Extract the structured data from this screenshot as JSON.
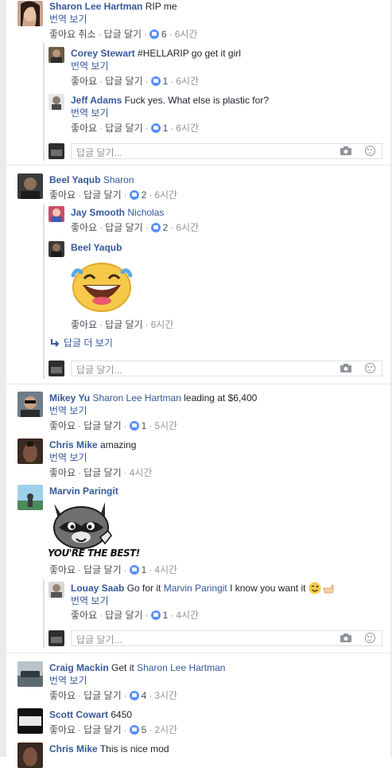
{
  "colors": {
    "link": "#365899",
    "meta": "#4b4f56",
    "time": "#90949c",
    "like": "#5890ff",
    "border": "#dddfe2"
  },
  "labels": {
    "like": "좋아요",
    "unlike": "좋아요 취소",
    "reply": "답글 달기",
    "translate": "번역 보기",
    "reply_placeholder": "답글 달기...",
    "more_replies": "답글 더 보기",
    "dot": "·"
  },
  "comments": [
    {
      "name": "Sharon Lee Hartman",
      "text": "RIP me",
      "translate": true,
      "like_label": "좋아요 취소",
      "likes": "6",
      "time": "6시간",
      "replies": [
        {
          "name": "Corey Stewart",
          "text": "#HELLARIP go get it girl",
          "translate": true,
          "likes": "1",
          "time": "6시간"
        },
        {
          "name": "Jeff Adams",
          "text": "Fuck yes. What else is plastic for?",
          "translate": true,
          "likes": "1",
          "time": "6시간"
        }
      ]
    },
    {
      "name": "Beel Yaqub",
      "text": "Sharon",
      "likes": "2",
      "time": "6시간",
      "replies": [
        {
          "name": "Jay Smooth",
          "text": "Nicholas",
          "likes": "2",
          "time": "6시간"
        },
        {
          "name": "Beel Yaqub",
          "text": "",
          "sticker": "laughing-tears-sticker",
          "time": "6시간"
        }
      ]
    },
    {
      "name": "Mikey Yu",
      "mention": "Sharon Lee Hartman",
      "text": " leading at $6,400",
      "translate": true,
      "likes": "1",
      "time": "5시간"
    },
    {
      "name": "Chris Mike",
      "text": "amazing",
      "translate": true,
      "time": "4시간"
    },
    {
      "name": "Marvin Paringit",
      "text": "",
      "sticker": "raccoon-sticker",
      "sticker_text": "YOU'RE THE BEST!",
      "likes": "1",
      "time": "4시간",
      "replies": [
        {
          "name": "Louay Saab",
          "text_before": "Go for it ",
          "mention": "Marvin Paringit",
          "text_after": " I know you want it",
          "translate": true,
          "likes": "1",
          "time": "4시간"
        }
      ]
    },
    {
      "name": "Craig Mackin",
      "text_before": "Get it ",
      "mention": "Sharon Lee Hartman",
      "translate": true,
      "likes": "4",
      "time": "3시간"
    },
    {
      "name": "Scott Cowart",
      "text": "6450",
      "likes": "5",
      "time": "2시간"
    },
    {
      "name": "Chris Mike",
      "text": "This is nice mod"
    }
  ]
}
